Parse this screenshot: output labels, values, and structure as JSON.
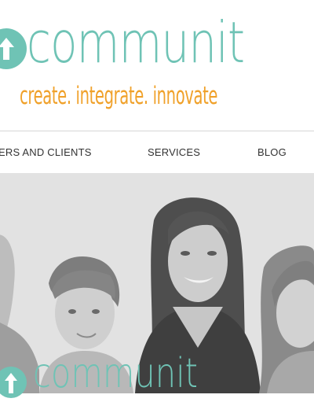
{
  "brand": {
    "name": "communit",
    "tagline": "create. integrate. innovate",
    "colors": {
      "teal": "#6fc3b5",
      "orange": "#f0a12a"
    }
  },
  "nav": {
    "items": [
      {
        "label": "ERS AND CLIENTS"
      },
      {
        "label": "SERVICES"
      },
      {
        "label": "BLOG"
      }
    ]
  },
  "hero": {
    "image": "group-of-people-photo",
    "overlay_logo_text": "communit"
  }
}
